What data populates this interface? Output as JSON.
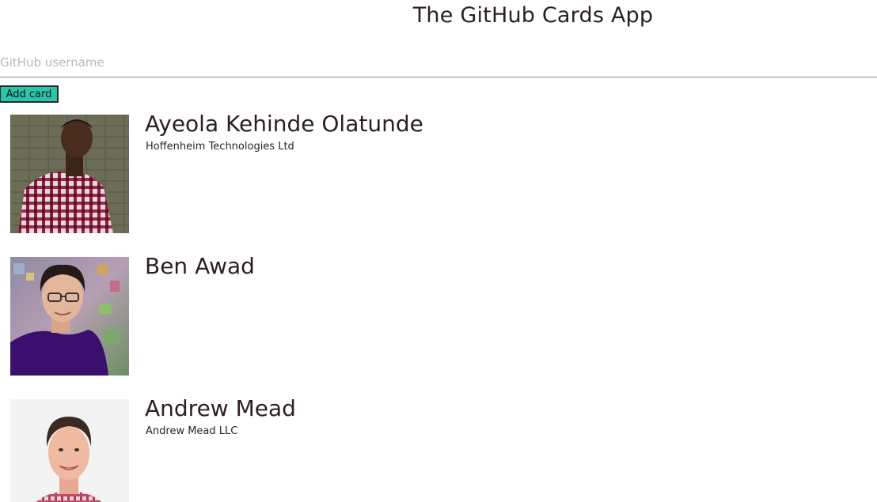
{
  "app": {
    "title": "The GitHub Cards App"
  },
  "form": {
    "username_placeholder": "GitHub username",
    "add_button_label": "Add card"
  },
  "cards": [
    {
      "name": "Ayeola Kehinde Olatunde",
      "company": "Hoffenheim Technologies Ltd",
      "avatar": "avatar-young-man-plaid-shirt"
    },
    {
      "name": "Ben Awad",
      "company": "",
      "avatar": "avatar-man-glasses-purple-shirt"
    },
    {
      "name": "Andrew Mead",
      "company": "Andrew Mead LLC",
      "avatar": "avatar-man-smiling-plaid-shirt"
    }
  ],
  "colors": {
    "button_bg": "#28c6a6",
    "text": "#2c1f1f",
    "placeholder": "#b8b8b8"
  }
}
